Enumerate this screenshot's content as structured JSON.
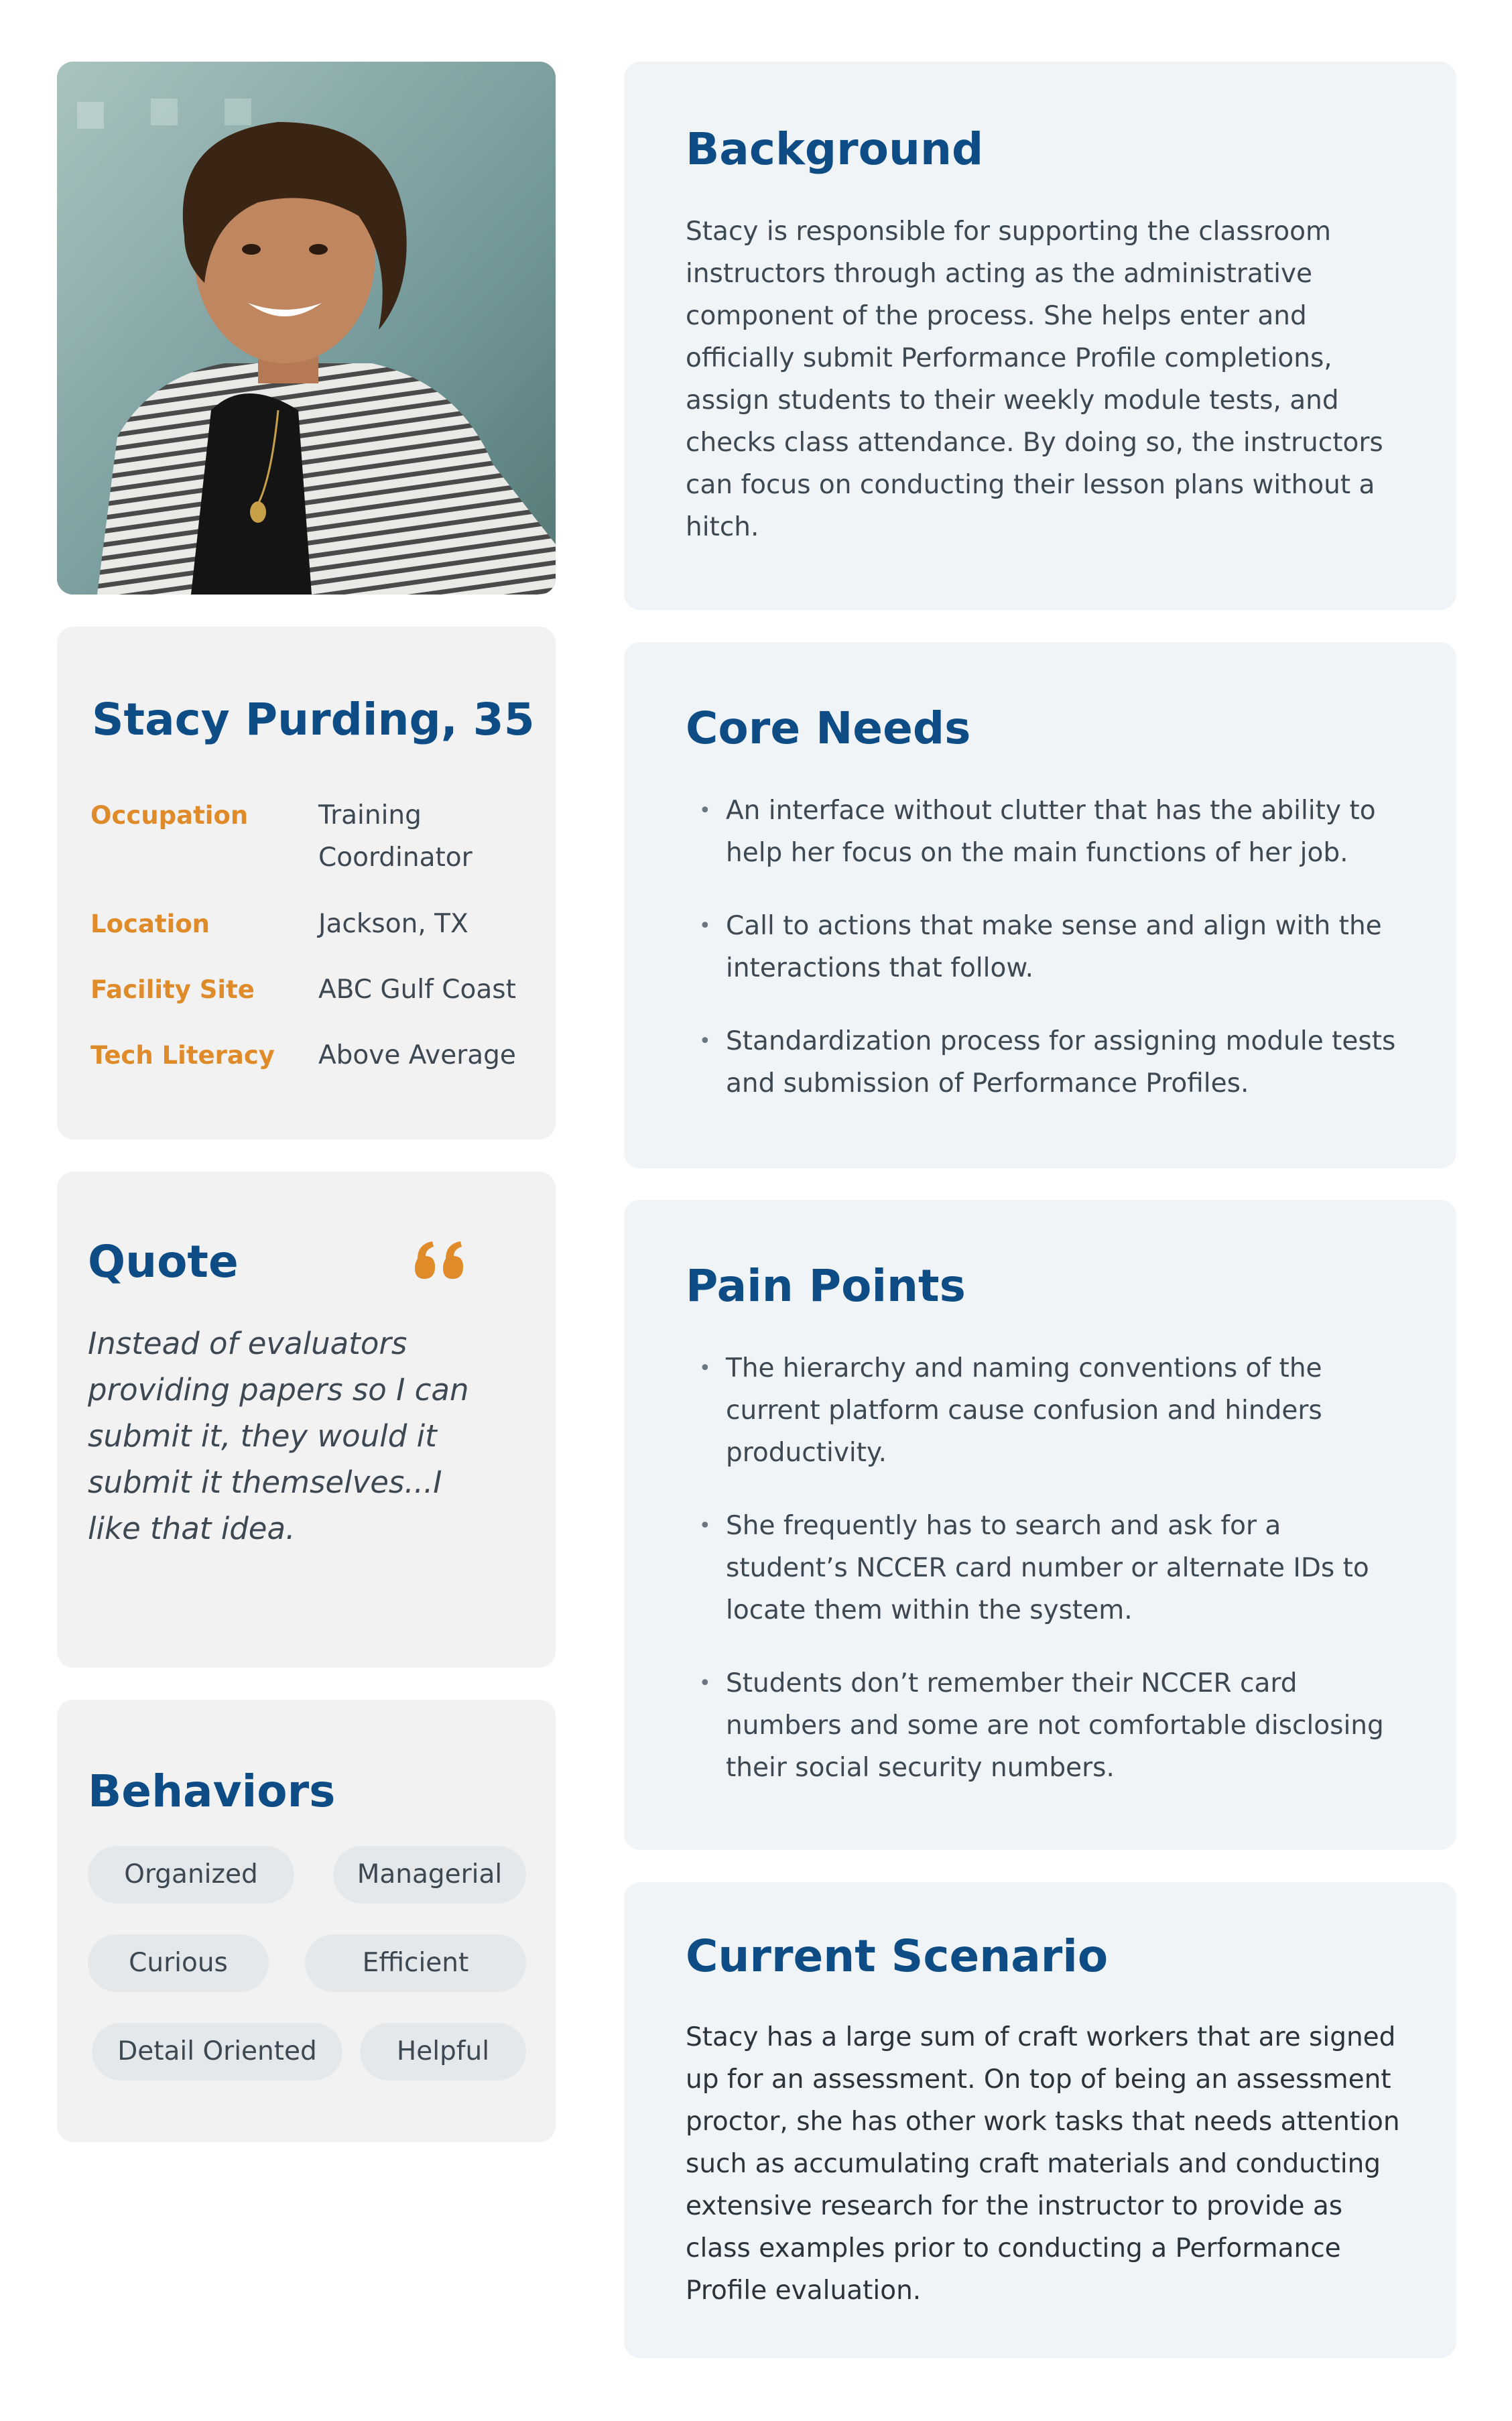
{
  "persona": {
    "name": "Stacy Purding, 35",
    "info": [
      {
        "label": "Occupation",
        "value": "Training Coordinator"
      },
      {
        "label": "Location",
        "value": "Jackson, TX"
      },
      {
        "label": "Facility Site",
        "value": "ABC Gulf Coast"
      },
      {
        "label": "Tech Literacy",
        "value": "Above Average"
      }
    ]
  },
  "quote": {
    "title": "Quote",
    "text": "Instead of evaluators providing papers so I can submit it, they would it submit it themselves...I like that idea."
  },
  "behaviors": {
    "title": "Behaviors",
    "tags": [
      "Organized",
      "Managerial",
      "Curious",
      "Efficient",
      "Detail Oriented",
      "Helpful"
    ]
  },
  "background": {
    "title": "Background",
    "text": "Stacy is responsible for supporting the classroom instructors through acting as the administrative component of the process. She helps enter and officially submit Performance Profile completions, assign students to their weekly module tests, and checks class attendance. By doing so, the instructors can focus on conducting their lesson plans without a hitch."
  },
  "core_needs": {
    "title": "Core Needs",
    "items": [
      "An interface without clutter that has the ability to help her focus on the main functions of her job.",
      "Call to actions that make sense and align with the interactions that follow.",
      "Standardization process for assigning module tests and submission of Performance Profiles."
    ]
  },
  "pain_points": {
    "title": "Pain Points",
    "items": [
      "The hierarchy and naming conventions of the current platform cause confusion and hinders productivity.",
      "She frequently has to search and ask for a student’s NCCER card number or alternate IDs to locate them within the system.",
      "Students don’t remember their NCCER card numbers and some are not comfortable disclosing their social security numbers."
    ]
  },
  "current_scenario": {
    "title": "Current Scenario",
    "text": "Stacy has a large sum of craft workers that are signed up for an assessment. On top of being an assessment proctor, she has other work tasks that needs attention such as accumulating craft materials and conducting extensive research for the instructor to provide as class examples prior to conducting a Performance Profile evaluation."
  },
  "colors": {
    "heading": "#0e4c85",
    "accent": "#e08b2a",
    "card_left": "#f2f2f3",
    "card_right": "#f0f4f7",
    "body_text": "#3d4852"
  },
  "icons": {
    "quote": "quote-icon"
  }
}
